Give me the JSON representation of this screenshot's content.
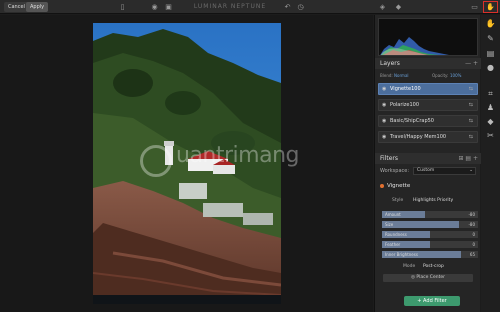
{
  "topbar": {
    "cancel_label": "Cancel",
    "apply_label": "Apply",
    "title": "LUMINAR NEPTUNE"
  },
  "watermark": {
    "text": "uantrimang"
  },
  "layers": {
    "title": "Layers",
    "blend_label": "Blend:",
    "blend_value": "Normal",
    "opacity_label": "Opacity:",
    "opacity_value": "100%",
    "items": [
      {
        "label": "Vignette100",
        "selected": true
      },
      {
        "label": "Polarize100",
        "selected": false
      },
      {
        "label": "Basic/ShipCrap50",
        "selected": false
      },
      {
        "label": "Travel/Happy Mem100",
        "selected": false
      }
    ]
  },
  "filters": {
    "title": "Filters",
    "workspace_label": "Workspace:",
    "workspace_value": "Custom",
    "filter_name": "Vignette",
    "style_label": "Style",
    "style_value": "Highlights Priority",
    "sliders": [
      {
        "label": "Amount",
        "value": "-80",
        "fraction": 0.45
      },
      {
        "label": "Size",
        "value": "-80",
        "fraction": 0.8
      },
      {
        "label": "Roundness",
        "value": "0",
        "fraction": 0.5
      },
      {
        "label": "Feather",
        "value": "0",
        "fraction": 0.5
      },
      {
        "label": "Inner Brightness",
        "value": "65",
        "fraction": 0.82
      }
    ],
    "mode_label": "Mode",
    "mode_value": "Post-crop",
    "place_center_label": "Place Center",
    "add_filter_label": "+ Add Filter"
  },
  "colors": {
    "accent": "#4c6e9c",
    "add_filter": "#3d9a6e",
    "highlight": "#d9302a"
  }
}
